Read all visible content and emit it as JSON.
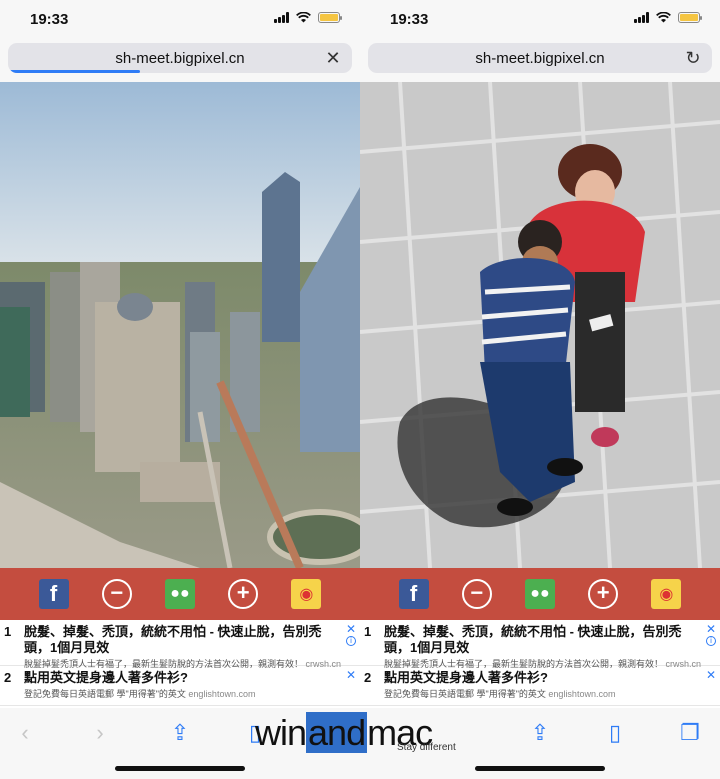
{
  "panes": [
    {
      "time": "19:33",
      "url": "sh-meet.bigpixel.cn",
      "url_action_icon": "close-icon",
      "ads": [
        {
          "num": "1",
          "title": "脫髮、掉髮、禿頂，統統不用怕 - 快速止脫，告別禿頭，1個月見效",
          "desc": "脫髮掉髮禿頂人士有福了，最新生髮防脫的方法首次公開，親測有效！",
          "source": "crwsh.cn"
        },
        {
          "num": "2",
          "title": "點用英文提身邊人著多件衫?",
          "desc": "登記免費每日英語電郵 學\"用得著\"的英文",
          "source": "englishtown.com"
        }
      ]
    },
    {
      "time": "19:33",
      "url": "sh-meet.bigpixel.cn",
      "url_action_icon": "reload-icon",
      "ads": [
        {
          "num": "1",
          "title": "脫髮、掉髮、禿頂，統統不用怕 - 快速止脫，告別禿頭，1個月見效",
          "desc": "脫髮掉髮禿頂人士有福了，最新生髮防脫的方法首次公開，親測有效！",
          "source": "crwsh.cn"
        },
        {
          "num": "2",
          "title": "點用英文提身邊人著多件衫?",
          "desc": "登記免費每日英語電郵 學\"用得著\"的英文",
          "source": "englishtown.com"
        }
      ]
    }
  ],
  "watermark": {
    "text_a": "win",
    "text_b": "and",
    "text_c": "mac",
    "tagline": "Stay different"
  },
  "colors": {
    "share_bar": "#c44d3f",
    "accent": "#2f7cf6",
    "battery": "#f5c542"
  }
}
